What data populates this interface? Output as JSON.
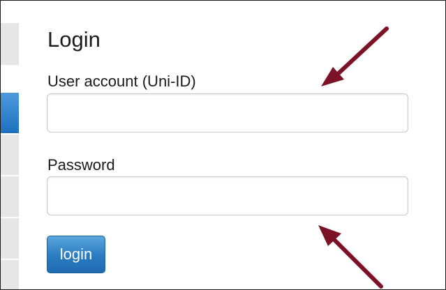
{
  "login": {
    "title": "Login",
    "user_label": "User account (Uni-ID)",
    "user_value": "",
    "password_label": "Password",
    "password_value": "",
    "button_label": "login"
  },
  "colors": {
    "arrow": "#7b1226",
    "button": "#2a7bc2",
    "sidebar_active": "#2a7bc2",
    "sidebar_tab": "#e6e6e6"
  },
  "annotations": [
    {
      "name": "arrow-to-user-field",
      "icon": "arrow-icon"
    },
    {
      "name": "arrow-to-password-field",
      "icon": "arrow-icon"
    }
  ]
}
